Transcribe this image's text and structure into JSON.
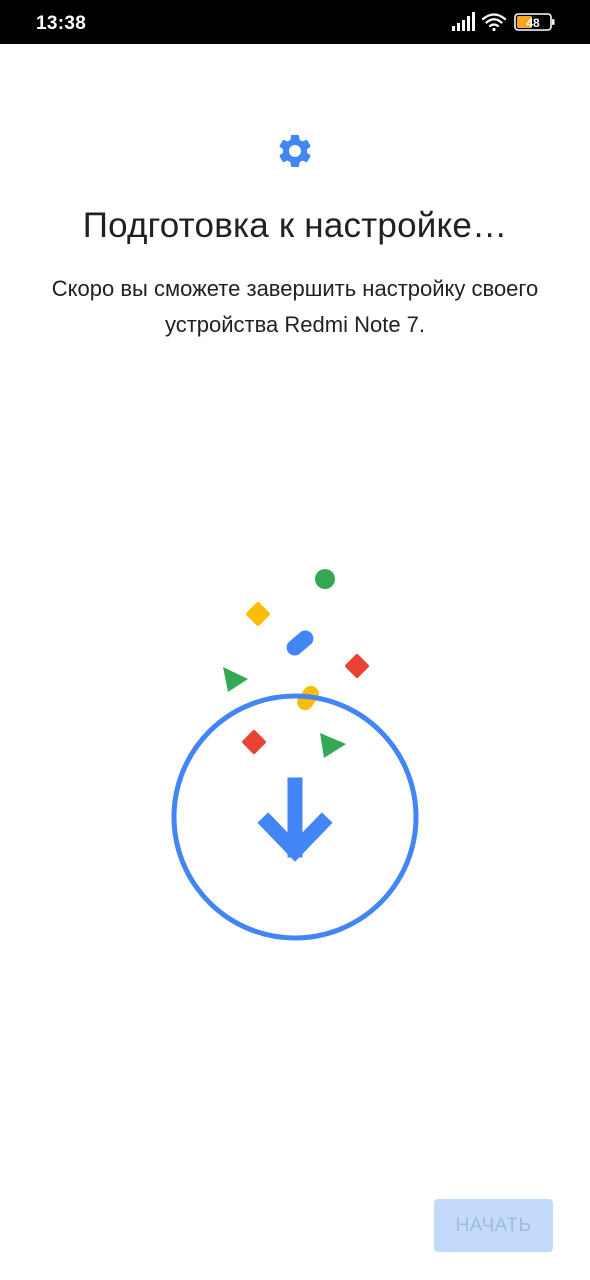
{
  "status_bar": {
    "time": "13:38",
    "battery_level": "48",
    "icons": [
      "signal-icon",
      "wifi-icon",
      "battery-icon"
    ]
  },
  "setup": {
    "icon": "gear-icon",
    "title": "Подготовка к настройке…",
    "subtitle": "Скоро вы сможете завершить настройку своего устройства Redmi Note 7."
  },
  "illustration": {
    "icon": "download-arrow-icon",
    "colors": {
      "blue": "#4285f4",
      "red": "#ea4335",
      "yellow": "#fbbc04",
      "green": "#34a853"
    }
  },
  "footer": {
    "start_label": "НАЧАТЬ",
    "start_enabled": false
  }
}
